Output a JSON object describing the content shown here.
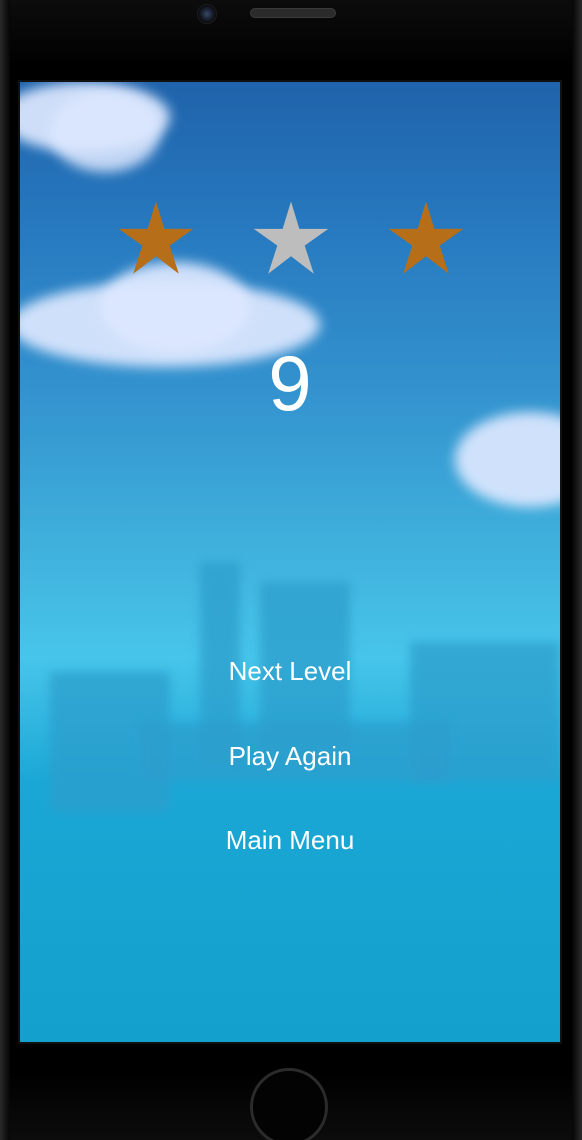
{
  "game": {
    "stars": [
      {
        "earned": true,
        "color": "#b66f18"
      },
      {
        "earned": false,
        "color": "#bdbdbd"
      },
      {
        "earned": true,
        "color": "#b66f18"
      }
    ],
    "score": "9"
  },
  "menu": {
    "next_level": "Next Level",
    "play_again": "Play Again",
    "main_menu": "Main Menu"
  },
  "colors": {
    "sky_top": "#1f63ab",
    "sky_bottom": "#14a0cc",
    "star_earned": "#b66f18",
    "star_empty": "#bdbdbd",
    "text": "#ffffff"
  },
  "icons": [
    "camera-icon",
    "speaker-grille",
    "home-button-icon",
    "star-icon"
  ]
}
